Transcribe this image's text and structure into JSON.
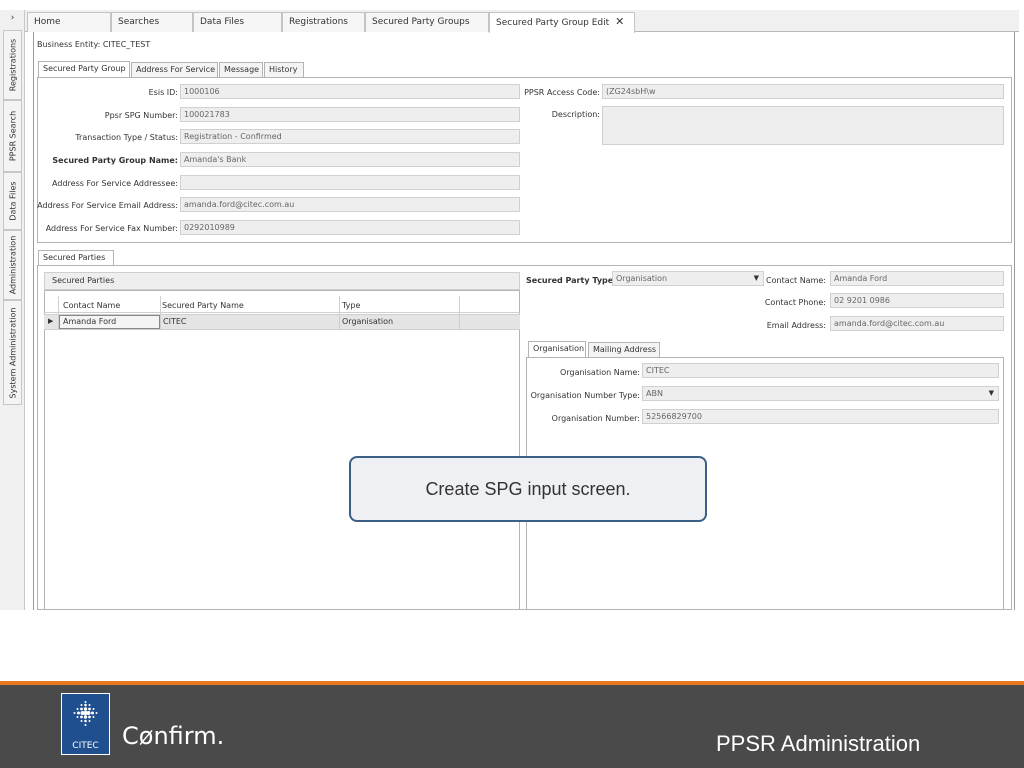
{
  "sidebar": {
    "expand": "›",
    "tabs": [
      "Registrations",
      "PPSR Search",
      "Data Files",
      "Administration",
      "System Administration"
    ]
  },
  "top_tabs": [
    "Home",
    "Searches",
    "Data Files",
    "Registrations",
    "Secured Party Groups",
    "Secured Party Group Edit"
  ],
  "close_glyph": "✕",
  "business_entity": "Business Entity:  CITEC_TEST",
  "detail_tabs": [
    "Secured Party Group",
    "Address For Service",
    "Message",
    "History"
  ],
  "form": {
    "esis_id": {
      "label": "Esis ID:",
      "value": "1000106"
    },
    "ppsr_spg_number": {
      "label": "Ppsr SPG Number:",
      "value": "100021783"
    },
    "transaction": {
      "label": "Transaction Type / Status:",
      "value": "Registration - Confirmed"
    },
    "spg_name": {
      "label": "Secured Party Group Name:",
      "value": "Amanda's Bank"
    },
    "afs_addressee": {
      "label": "Address For Service Addressee:",
      "value": ""
    },
    "afs_email": {
      "label": "Address For Service Email Address:",
      "value": "amanda.ford@citec.com.au"
    },
    "afs_fax": {
      "label": "Address For Service Fax Number:",
      "value": "0292010989"
    },
    "access_code": {
      "label": "PPSR Access Code:",
      "value": "(ZG24sbH\\w"
    },
    "description": {
      "label": "Description:",
      "value": ""
    }
  },
  "secured_parties": {
    "tab": "Secured Parties",
    "grid_title": "Secured Parties",
    "columns": [
      "Contact Name",
      "Secured Party Name",
      "Type"
    ],
    "rows": [
      {
        "marker": "▶",
        "contact": "Amanda Ford",
        "name": "CITEC",
        "type": "Organisation"
      }
    ]
  },
  "party_detail": {
    "type": {
      "label": "Secured Party Type:",
      "value": "Organisation"
    },
    "contact_name": {
      "label": "Contact Name:",
      "value": "Amanda Ford"
    },
    "contact_phone": {
      "label": "Contact Phone:",
      "value": "02 9201 0986"
    },
    "email": {
      "label": "Email Address:",
      "value": "amanda.ford@citec.com.au"
    },
    "tabs": [
      "Organisation",
      "Mailing Address"
    ],
    "org_name": {
      "label": "Organisation Name:",
      "value": "CITEC"
    },
    "org_number_type": {
      "label": "Organisation Number Type:",
      "value": "ABN"
    },
    "org_number": {
      "label": "Organisation Number:",
      "value": "52566829700"
    }
  },
  "callout": "Create SPG input screen.",
  "footer": {
    "logo_text": "CITEC",
    "brand": "Cønfirm.",
    "title": "PPSR Administration",
    "accent": "#e87722",
    "background": "#4a4a4a"
  }
}
